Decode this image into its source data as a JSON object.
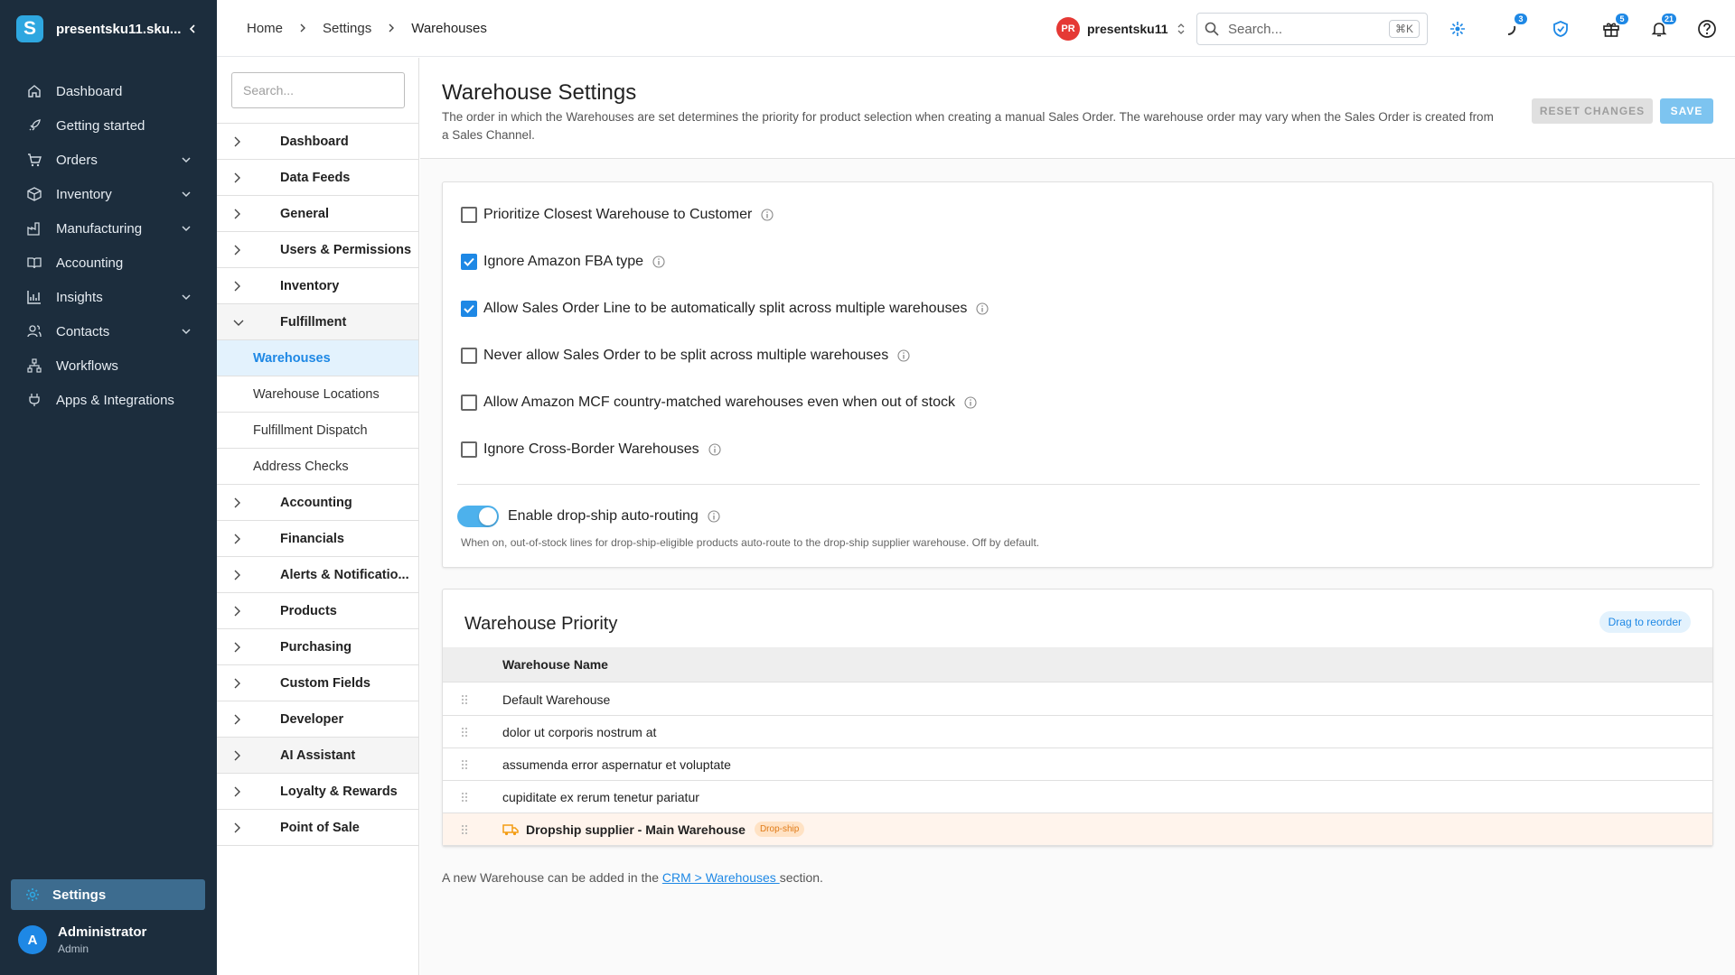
{
  "sidebar": {
    "org_name": "presentsku11.sku...",
    "logo_letter": "S",
    "items": [
      {
        "label": "Dashboard",
        "icon": "home-icon"
      },
      {
        "label": "Getting started",
        "icon": "rocket-icon"
      },
      {
        "label": "Orders",
        "icon": "cart-icon",
        "expandable": true
      },
      {
        "label": "Inventory",
        "icon": "box-icon",
        "expandable": true
      },
      {
        "label": "Manufacturing",
        "icon": "factory-icon",
        "expandable": true
      },
      {
        "label": "Accounting",
        "icon": "book-icon"
      },
      {
        "label": "Insights",
        "icon": "bar-chart-icon",
        "expandable": true
      },
      {
        "label": "Contacts",
        "icon": "people-icon",
        "expandable": true
      },
      {
        "label": "Workflows",
        "icon": "workflow-icon"
      },
      {
        "label": "Apps & Integrations",
        "icon": "plug-icon"
      }
    ],
    "settings_label": "Settings",
    "user": {
      "initial": "A",
      "name": "Administrator",
      "role": "Admin"
    }
  },
  "topbar": {
    "breadcrumbs": [
      "Home",
      "Settings",
      "Warehouses"
    ],
    "account_initials": "PR",
    "account_name": "presentsku11",
    "search_placeholder": "Search...",
    "search_shortcut": "⌘K",
    "badges": {
      "tasks": "3",
      "gifts": "5",
      "notifications": "21"
    }
  },
  "settings_nav": {
    "search_placeholder": "Search...",
    "items_before": [
      "Dashboard",
      "Data Feeds",
      "General",
      "Users & Permissions",
      "Inventory"
    ],
    "expanded": "Fulfillment",
    "children": [
      "Warehouses",
      "Warehouse Locations",
      "Fulfillment Dispatch",
      "Address Checks"
    ],
    "active_child": "Warehouses",
    "items_after": [
      "Accounting",
      "Financials",
      "Alerts & Notificatio...",
      "Products",
      "Purchasing",
      "Custom Fields",
      "Developer",
      "AI Assistant",
      "Loyalty & Rewards",
      "Point of Sale"
    ]
  },
  "page": {
    "title": "Warehouse Settings",
    "description": "The order in which the Warehouses are set determines the priority for product selection when creating a manual Sales Order. The warehouse order may vary when the Sales Order is created from a Sales Channel.",
    "reset_label": "RESET CHANGES",
    "save_label": "SAVE"
  },
  "options": [
    {
      "label": "Prioritize Closest Warehouse to Customer",
      "checked": false
    },
    {
      "label": "Ignore Amazon FBA type",
      "checked": true
    },
    {
      "label": "Allow Sales Order Line to be automatically split across multiple warehouses",
      "checked": true
    },
    {
      "label": "Never allow Sales Order to be split across multiple warehouses",
      "checked": false
    },
    {
      "label": "Allow Amazon MCF country-matched warehouses even when out of stock",
      "checked": false
    },
    {
      "label": "Ignore Cross-Border Warehouses",
      "checked": false
    }
  ],
  "dropship_toggle": {
    "label": "Enable drop-ship auto-routing",
    "on": true,
    "help": "When on, out-of-stock lines for drop-ship-eligible products auto-route to the drop-ship supplier warehouse. Off by default."
  },
  "priority": {
    "title": "Warehouse Priority",
    "drag_hint": "Drag to reorder",
    "column": "Warehouse Name",
    "rows": [
      {
        "name": "Default Warehouse"
      },
      {
        "name": "dolor ut corporis nostrum at"
      },
      {
        "name": "assumenda error aspernatur et voluptate"
      },
      {
        "name": "cupiditate ex rerum tenetur pariatur"
      },
      {
        "name": "Dropship supplier - Main Warehouse",
        "tag": "Drop-ship"
      }
    ]
  },
  "footnote": {
    "before": "A new Warehouse can be added in the ",
    "link": "CRM > Warehouses ",
    "after": "section."
  },
  "colors": {
    "accent": "#1e88e5",
    "sidebar_bg": "#1c2d3d",
    "dropship_row": "#fff4ec"
  }
}
